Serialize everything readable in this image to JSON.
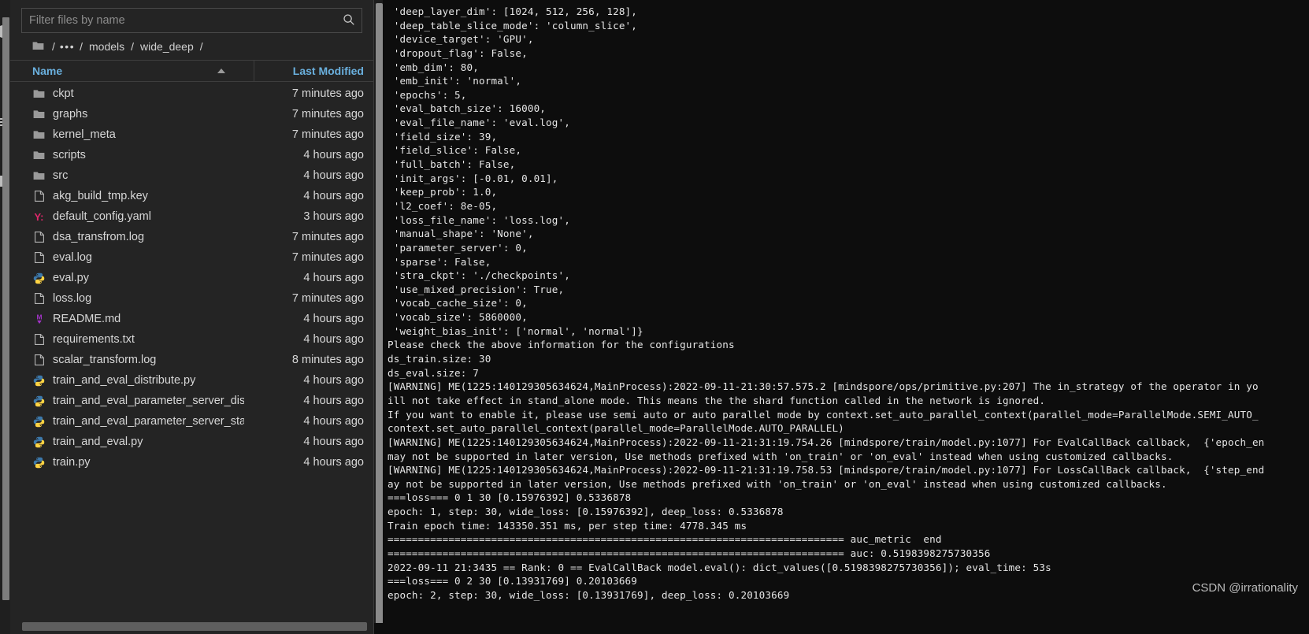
{
  "rail": {
    "icons": [
      "circle-avatar-icon",
      "menu-icon",
      "plus-icon"
    ]
  },
  "file_browser": {
    "search": {
      "placeholder": "Filter files by name",
      "value": "",
      "icon": "search-icon"
    },
    "breadcrumb": {
      "folder_icon": "folder-icon",
      "root": "/",
      "ellipsis": "•••",
      "segments": [
        "models",
        "wide_deep"
      ],
      "separator": "/"
    },
    "columns": {
      "name": "Name",
      "last_modified": "Last Modified",
      "sort_icon": "sort-ascending-icon"
    },
    "files": [
      {
        "name": "ckpt",
        "modified": "7 minutes ago",
        "icon": "folder-icon",
        "type": "folder"
      },
      {
        "name": "graphs",
        "modified": "7 minutes ago",
        "icon": "folder-icon",
        "type": "folder"
      },
      {
        "name": "kernel_meta",
        "modified": "7 minutes ago",
        "icon": "folder-icon",
        "type": "folder"
      },
      {
        "name": "scripts",
        "modified": "4 hours ago",
        "icon": "folder-icon",
        "type": "folder"
      },
      {
        "name": "src",
        "modified": "4 hours ago",
        "icon": "folder-icon",
        "type": "folder"
      },
      {
        "name": "akg_build_tmp.key",
        "modified": "4 hours ago",
        "icon": "file-icon",
        "type": "file"
      },
      {
        "name": "default_config.yaml",
        "modified": "3 hours ago",
        "icon": "yaml-icon",
        "type": "yaml"
      },
      {
        "name": "dsa_transfrom.log",
        "modified": "7 minutes ago",
        "icon": "file-icon",
        "type": "file"
      },
      {
        "name": "eval.log",
        "modified": "7 minutes ago",
        "icon": "file-icon",
        "type": "file"
      },
      {
        "name": "eval.py",
        "modified": "4 hours ago",
        "icon": "python-icon",
        "type": "python"
      },
      {
        "name": "loss.log",
        "modified": "7 minutes ago",
        "icon": "file-icon",
        "type": "file"
      },
      {
        "name": "README.md",
        "modified": "4 hours ago",
        "icon": "markdown-icon",
        "type": "markdown"
      },
      {
        "name": "requirements.txt",
        "modified": "4 hours ago",
        "icon": "file-icon",
        "type": "file"
      },
      {
        "name": "scalar_transform.log",
        "modified": "8 minutes ago",
        "icon": "file-icon",
        "type": "file"
      },
      {
        "name": "train_and_eval_distribute.py",
        "modified": "4 hours ago",
        "icon": "python-icon",
        "type": "python"
      },
      {
        "name": "train_and_eval_parameter_server_distribute....",
        "modified": "4 hours ago",
        "icon": "python-icon",
        "type": "python"
      },
      {
        "name": "train_and_eval_parameter_server_standalon...",
        "modified": "4 hours ago",
        "icon": "python-icon",
        "type": "python"
      },
      {
        "name": "train_and_eval.py",
        "modified": "4 hours ago",
        "icon": "python-icon",
        "type": "python"
      },
      {
        "name": "train.py",
        "modified": "4 hours ago",
        "icon": "python-icon",
        "type": "python"
      }
    ]
  },
  "terminal": {
    "lines": [
      " 'deep_layer_dim': [1024, 512, 256, 128],",
      " 'deep_table_slice_mode': 'column_slice',",
      " 'device_target': 'GPU',",
      " 'dropout_flag': False,",
      " 'emb_dim': 80,",
      " 'emb_init': 'normal',",
      " 'epochs': 5,",
      " 'eval_batch_size': 16000,",
      " 'eval_file_name': 'eval.log',",
      " 'field_size': 39,",
      " 'field_slice': False,",
      " 'full_batch': False,",
      " 'init_args': [-0.01, 0.01],",
      " 'keep_prob': 1.0,",
      " 'l2_coef': 8e-05,",
      " 'loss_file_name': 'loss.log',",
      " 'manual_shape': 'None',",
      " 'parameter_server': 0,",
      " 'sparse': False,",
      " 'stra_ckpt': './checkpoints',",
      " 'use_mixed_precision': True,",
      " 'vocab_cache_size': 0,",
      " 'vocab_size': 5860000,",
      " 'weight_bias_init': ['normal', 'normal']}",
      "Please check the above information for the configurations",
      "ds_train.size: 30",
      "ds_eval.size: 7",
      "[WARNING] ME(1225:140129305634624,MainProcess):2022-09-11-21:30:57.575.2 [mindspore/ops/primitive.py:207] The in_strategy of the operator in yo",
      "ill not take effect in stand_alone mode. This means the the shard function called in the network is ignored.",
      "If you want to enable it, please use semi auto or auto parallel mode by context.set_auto_parallel_context(parallel_mode=ParallelMode.SEMI_AUTO_",
      "context.set_auto_parallel_context(parallel_mode=ParallelMode.AUTO_PARALLEL)",
      "[WARNING] ME(1225:140129305634624,MainProcess):2022-09-11-21:31:19.754.26 [mindspore/train/model.py:1077] For EvalCallBack callback,  {'epoch_en",
      "may not be supported in later version, Use methods prefixed with 'on_train' or 'on_eval' instead when using customized callbacks.",
      "[WARNING] ME(1225:140129305634624,MainProcess):2022-09-11-21:31:19.758.53 [mindspore/train/model.py:1077] For LossCallBack callback,  {'step_end",
      "ay not be supported in later version, Use methods prefixed with 'on_train' or 'on_eval' instead when using customized callbacks.",
      "===loss=== 0 1 30 [0.15976392] 0.5336878",
      "epoch: 1, step: 30, wide_loss: [0.15976392], deep_loss: 0.5336878",
      "Train epoch time: 143350.351 ms, per step time: 4778.345 ms",
      "=========================================================================== auc_metric  end",
      "=========================================================================== auc: 0.5198398275730356",
      "2022-09-11 21:3435 == Rank: 0 == EvalCallBack model.eval(): dict_values([0.5198398275730356]); eval_time: 53s",
      "===loss=== 0 2 30 [0.13931769] 0.20103669",
      "epoch: 2, step: 30, wide_loss: [0.13931769], deep_loss: 0.20103669"
    ]
  },
  "watermark": {
    "text": "CSDN @irrationality"
  },
  "colors": {
    "panel_bg": "#242424",
    "terminal_bg": "#0d0d0d",
    "header_accent": "#6ab0de",
    "yaml": "#e0276b",
    "markdown": "#a333c8",
    "python_blue": "#3c78aa",
    "python_yellow": "#ffd343",
    "folder": "#9a9a9a"
  }
}
